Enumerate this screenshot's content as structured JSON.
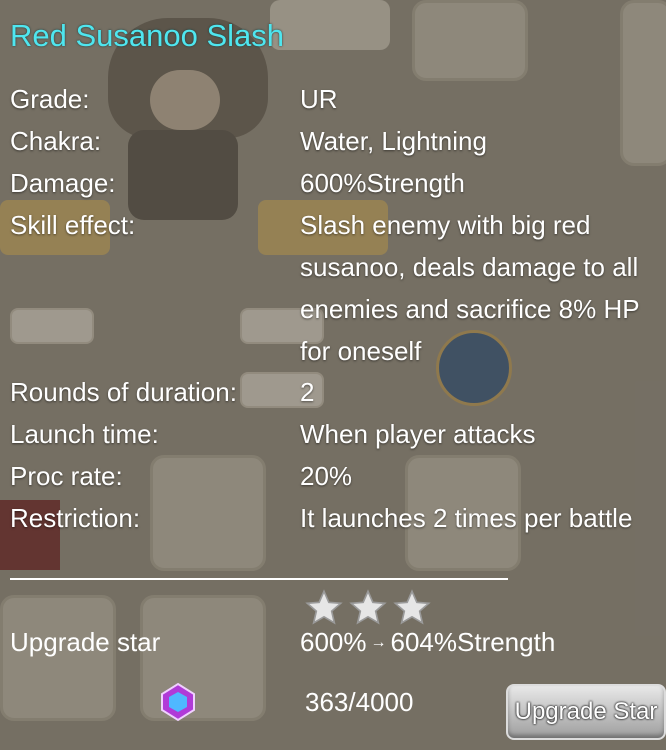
{
  "skill": {
    "title": "Red Susanoo Slash",
    "rows": [
      {
        "label": "Grade:",
        "value": "UR"
      },
      {
        "label": "Chakra:",
        "value": "Water, Lightning"
      },
      {
        "label": "Damage:",
        "value": "600%Strength"
      },
      {
        "label": "Skill effect:",
        "value": "Slash enemy with big red susanoo, deals damage to all enemies and sacrifice 8% HP for oneself"
      },
      {
        "label": "Rounds of duration:",
        "value": "2"
      },
      {
        "label": "Launch time:",
        "value": "When player attacks"
      },
      {
        "label": "Proc rate:",
        "value": "20%"
      },
      {
        "label": "Restriction:",
        "value": "It launches 2 times per battle"
      }
    ]
  },
  "upgrade": {
    "label": "Upgrade star",
    "stars_filled": 3,
    "from_value": "600%",
    "arrow": "→",
    "to_value": "604%Strength",
    "progress_text": "363/4000",
    "progress_current": 363,
    "progress_max": 4000,
    "button_label": "Upgrade Star",
    "gem_icon": "purple-gem-icon"
  },
  "colors": {
    "title": "#4fe6ef",
    "text": "#ffffff",
    "star": "#e6e6e6"
  }
}
